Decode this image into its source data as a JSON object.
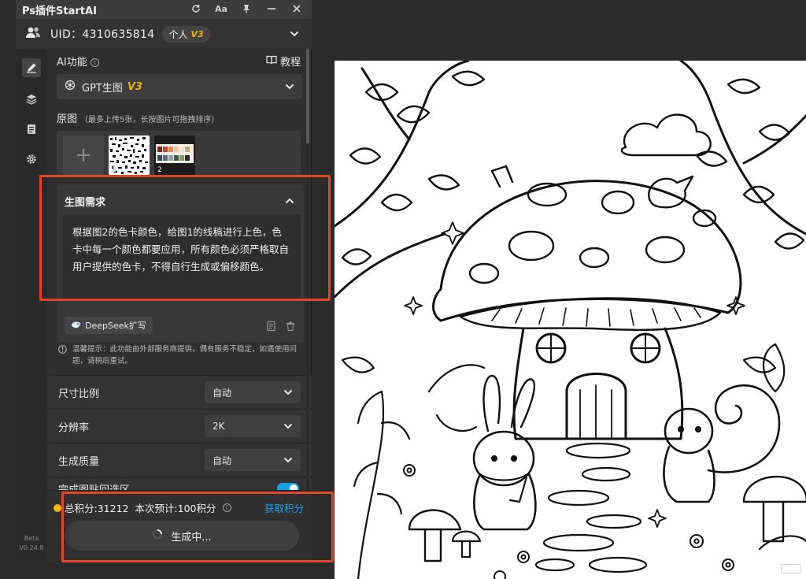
{
  "window": {
    "title": "Ps插件StartAI",
    "icons": [
      "refresh-icon",
      "font-size-icon",
      "pin-icon",
      "minimize-icon",
      "close-icon"
    ]
  },
  "user": {
    "uid_text": "UID：4310635814",
    "plan_label": "个人",
    "plan_version": "V3"
  },
  "sidebar": {
    "items": [
      "edit-icon",
      "layers-icon",
      "document-icon",
      "settings-icon"
    ],
    "active_index": 0,
    "version_tag": "Beta",
    "version": "V0.24.8"
  },
  "ai_function": {
    "label": "AI功能",
    "tutorial_label": "教程",
    "selected_model": "GPT生图",
    "selected_model_version": "V3"
  },
  "source_images": {
    "label": "原图",
    "hint": "（最多上传5张，长按图片可拖拽排序）",
    "thumbnails": [
      {
        "number": "1"
      },
      {
        "number": "2"
      }
    ]
  },
  "requirement": {
    "title": "生图需求",
    "text": "根据图2的色卡颜色，给图1的线稿进行上色，色卡中每一个颜色都要应用，所有颜色必须严格取自用户提供的色卡，不得自行生成或偏移颜色。",
    "expand_button_label": "DeepSeek扩写"
  },
  "warning": {
    "text": "温馨提示：此功能由外部服务商提供，偶有服务不稳定，如遇使用问题，请稍后重试。"
  },
  "options": [
    {
      "label": "尺寸比例",
      "value": "自动"
    },
    {
      "label": "分辨率",
      "value": "2K"
    },
    {
      "label": "生成质量",
      "value": "自动"
    }
  ],
  "partial_option": {
    "label": "完成图贴回选区",
    "enabled": true
  },
  "footer": {
    "points_text": "总积分:31212  本次预计:100积分",
    "get_points_label": "获取积分",
    "generate_label": "生成中..."
  },
  "colors": {
    "accent_blue": "#22a8ea",
    "version_gold": "#e9b214",
    "annotation_red": "#e2452a"
  }
}
